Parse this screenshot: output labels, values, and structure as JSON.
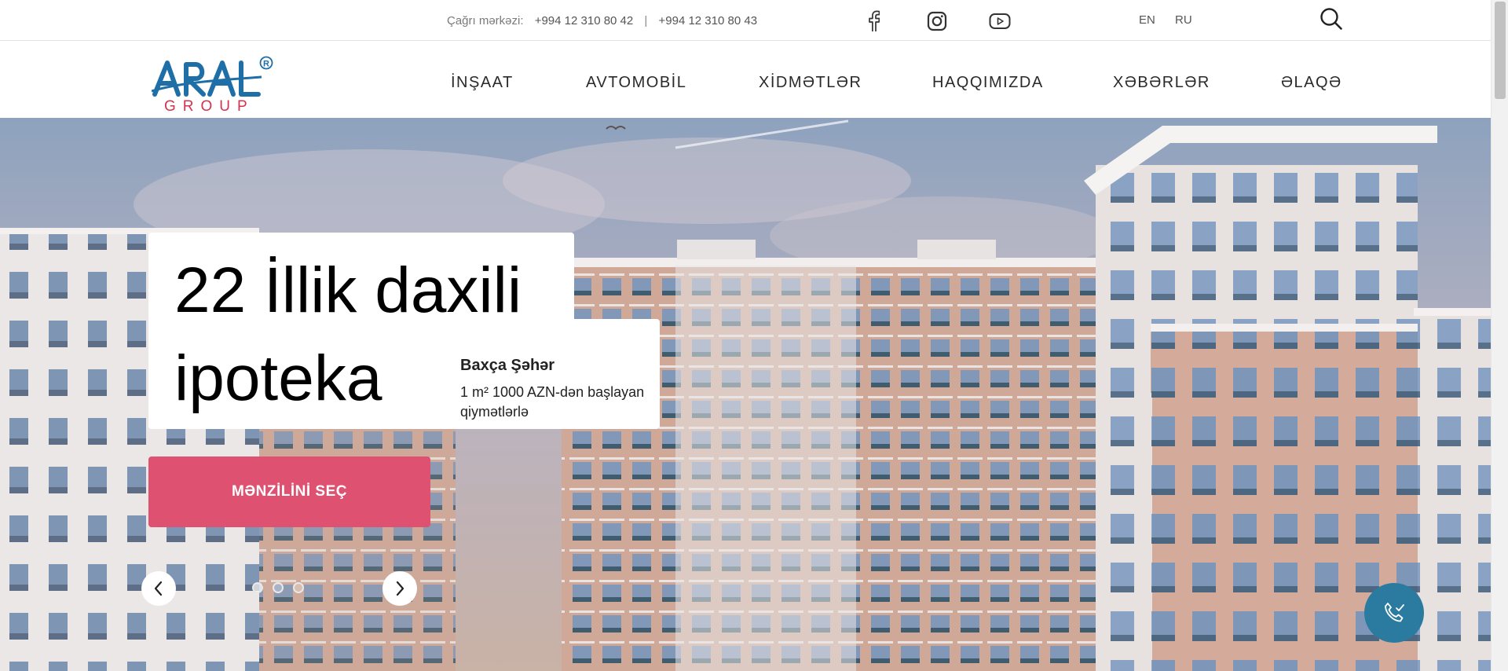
{
  "topbar": {
    "call_center_label": "Çağrı mərkəzi:",
    "phone_1": "+994 12 310 80 42",
    "separator": "|",
    "phone_2": "+994 12 310 80 43",
    "social": [
      "facebook-icon",
      "instagram-icon",
      "youtube-icon"
    ],
    "languages": [
      "EN",
      "RU"
    ],
    "search_icon": "search-icon"
  },
  "logo": {
    "word": "ARAL",
    "group": "GROUP",
    "mark": "®",
    "brand_color": "#1e6fa8",
    "accent_color": "#d6314d"
  },
  "nav": {
    "items": [
      "İNŞAAT",
      "AVTOMOBİL",
      "XİDMƏTLƏR",
      "HAQQIMIZDA",
      "XƏBƏRLƏR",
      "ƏLAQƏ"
    ]
  },
  "hero": {
    "headline": "22 İllik daxili ipoteka",
    "project_name": "Baxça Şəhər",
    "project_text": "1 m² 1000 AZN-dən başlayan qiymətlərlə",
    "cta_label": "MƏNZİLİNİ SEÇ",
    "cta_color": "#de5170",
    "slides": {
      "count": 3,
      "active": 1
    },
    "prev_icon": "chevron-left-icon",
    "next_icon": "chevron-right-icon"
  },
  "call_button": {
    "icon": "phone-call-icon",
    "color": "#2a7b9f"
  }
}
